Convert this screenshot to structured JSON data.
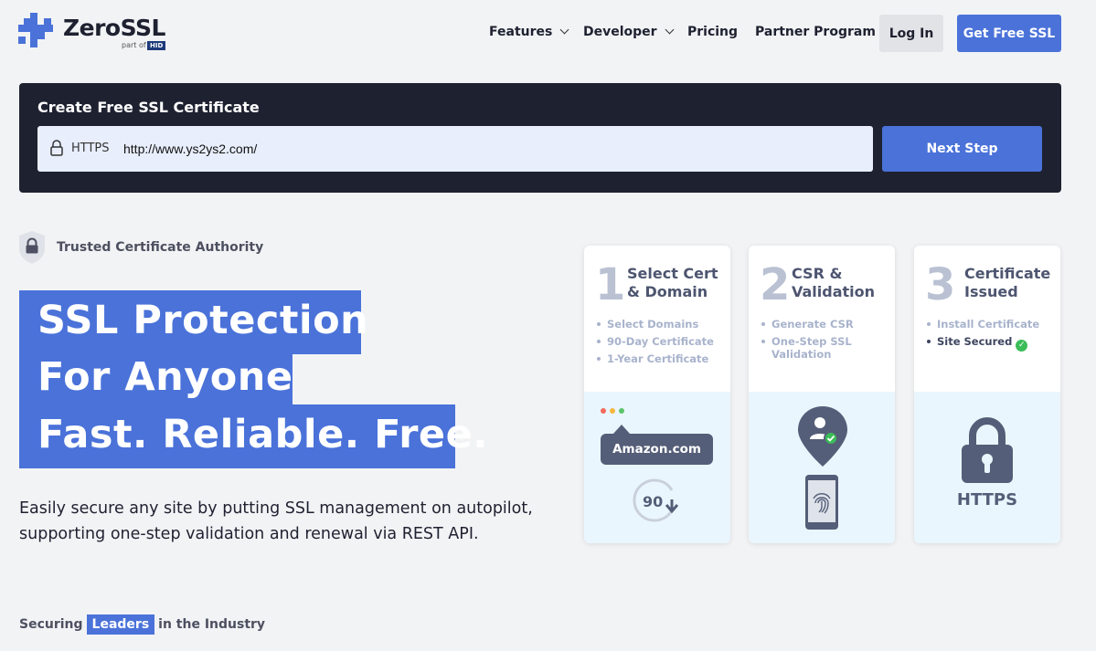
{
  "header": {
    "logo_text": "ZeroSSL",
    "logo_sub": "part of",
    "logo_hid": "HID",
    "nav": {
      "features": "Features",
      "developer": "Developer",
      "pricing": "Pricing",
      "partner": "Partner Program"
    },
    "login": "Log In",
    "get_free": "Get Free SSL"
  },
  "create": {
    "title": "Create Free SSL Certificate",
    "protocol": "HTTPS",
    "url_value": "http://www.ys2ys2.com/",
    "next": "Next Step"
  },
  "trusted": "Trusted Certificate Authority",
  "hero": {
    "line1": "SSL Protection",
    "line2": "For Anyone",
    "line3": "Fast. Reliable. Free.",
    "desc": "Easily secure any site by putting SSL management on autopilot, supporting one-step validation and renewal via REST API."
  },
  "steps": [
    {
      "num": "1",
      "title": "Select Cert & Domain",
      "items": [
        "Select Domains",
        "90-Day Certificate",
        "1-Year Certificate"
      ],
      "illustration": {
        "site": "Amazon.com",
        "days": "90"
      }
    },
    {
      "num": "2",
      "title": "CSR & Validation",
      "items": [
        "Generate CSR",
        "One-Step SSL Validation"
      ]
    },
    {
      "num": "3",
      "title": "Certificate Issued",
      "items": [
        "Install Certificate",
        "Site Secured"
      ],
      "illustration": {
        "label": "HTTPS"
      }
    }
  ],
  "securing": {
    "pre": "Securing",
    "highlight": "Leaders",
    "post": "in the Industry"
  },
  "colors": {
    "accent": "#4a72d9",
    "dark_panel": "#1e2130",
    "background": "#f2f3f5",
    "success": "#3bbd57"
  }
}
